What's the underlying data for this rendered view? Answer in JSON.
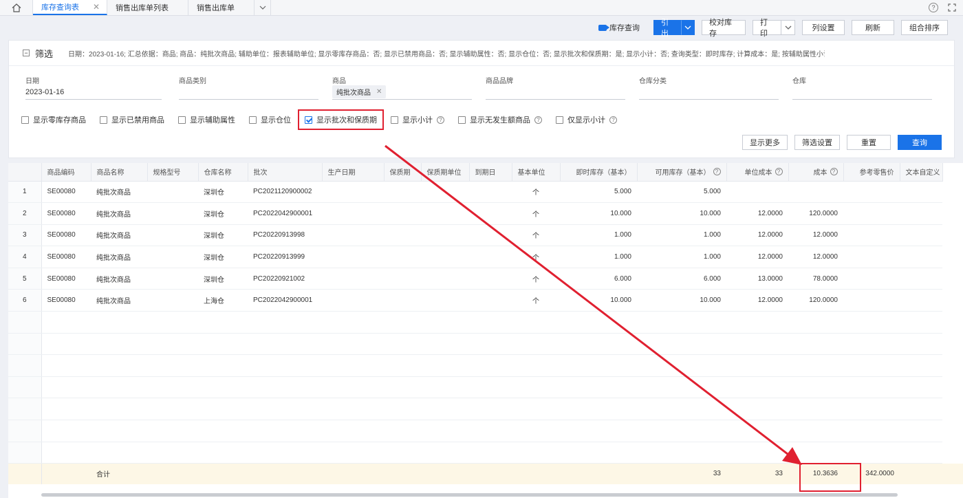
{
  "tabs": [
    {
      "label": "库存查询表",
      "active": true
    },
    {
      "label": "销售出库单列表",
      "active": false
    },
    {
      "label": "销售出库单",
      "active": false
    }
  ],
  "toolbar": {
    "live_query": "库存查询",
    "export": "引出",
    "verify_stock": "校对库存",
    "print": "打印",
    "column_settings": "列设置",
    "refresh": "刷新",
    "group_sort": "组合排序"
  },
  "filter": {
    "title": "筛选",
    "summary": "日期：2023-01-16; 汇总依据：商品; 商品：纯批次商品; 辅助单位：报表辅助单位; 显示零库存商品：否; 显示已禁用商品：否; 显示辅助属性：否; 显示仓位：否; 显示批次和保质期：是; 显示小计：否; 查询类型：即时库存; 计算成本：是; 按辅助属性小计：否",
    "fields": [
      {
        "label": "日期",
        "value": "2023-01-16"
      },
      {
        "label": "商品类别",
        "value": ""
      },
      {
        "label": "商品",
        "tag": "纯批次商品"
      },
      {
        "label": "商品品牌",
        "value": ""
      },
      {
        "label": "仓库分类",
        "value": ""
      },
      {
        "label": "仓库",
        "value": ""
      }
    ],
    "checkboxes": [
      {
        "label": "显示零库存商品",
        "checked": false
      },
      {
        "label": "显示已禁用商品",
        "checked": false
      },
      {
        "label": "显示辅助属性",
        "checked": false
      },
      {
        "label": "显示仓位",
        "checked": false
      },
      {
        "label": "显示批次和保质期",
        "checked": true
      },
      {
        "label": "显示小计",
        "checked": false
      },
      {
        "label": "显示无发生额商品",
        "checked": false
      },
      {
        "label": "仅显示小计",
        "checked": false
      }
    ],
    "buttons": {
      "more": "显示更多",
      "settings": "筛选设置",
      "reset": "重置",
      "query": "查询"
    }
  },
  "table": {
    "headers": [
      "商品编码",
      "商品名称",
      "规格型号",
      "仓库名称",
      "批次",
      "生产日期",
      "保质期",
      "保质期单位",
      "到期日",
      "基本单位",
      "即时库存（基本）",
      "可用库存（基本）",
      "单位成本",
      "成本",
      "参考零售价",
      "文本自定义"
    ],
    "rows": [
      {
        "idx": "1",
        "code": "SE00080",
        "name": "纯批次商品",
        "spec": "",
        "warehouse": "深圳仓",
        "batch": "PC2021120900002",
        "unit": "个",
        "stock": "5.000",
        "avail": "5.000",
        "unit_cost": "",
        "cost": ""
      },
      {
        "idx": "2",
        "code": "SE00080",
        "name": "纯批次商品",
        "spec": "",
        "warehouse": "深圳仓",
        "batch": "PC2022042900001",
        "unit": "个",
        "stock": "10.000",
        "avail": "10.000",
        "unit_cost": "12.0000",
        "cost": "120.0000"
      },
      {
        "idx": "3",
        "code": "SE00080",
        "name": "纯批次商品",
        "spec": "",
        "warehouse": "深圳仓",
        "batch": "PC20220913998",
        "unit": "个",
        "stock": "1.000",
        "avail": "1.000",
        "unit_cost": "12.0000",
        "cost": "12.0000"
      },
      {
        "idx": "4",
        "code": "SE00080",
        "name": "纯批次商品",
        "spec": "",
        "warehouse": "深圳仓",
        "batch": "PC20220913999",
        "unit": "个",
        "stock": "1.000",
        "avail": "1.000",
        "unit_cost": "12.0000",
        "cost": "12.0000"
      },
      {
        "idx": "5",
        "code": "SE00080",
        "name": "纯批次商品",
        "spec": "",
        "warehouse": "深圳仓",
        "batch": "PC20220921002",
        "unit": "个",
        "stock": "6.000",
        "avail": "6.000",
        "unit_cost": "13.0000",
        "cost": "78.0000"
      },
      {
        "idx": "6",
        "code": "SE00080",
        "name": "纯批次商品",
        "spec": "",
        "warehouse": "上海仓",
        "batch": "PC2022042900001",
        "unit": "个",
        "stock": "10.000",
        "avail": "10.000",
        "unit_cost": "12.0000",
        "cost": "120.0000"
      }
    ],
    "total": {
      "label": "合计",
      "stock": "33",
      "avail": "33",
      "unit_cost": "10.3636",
      "cost": "342.0000"
    }
  },
  "colors": {
    "accent": "#1a73e8",
    "annotation": "#e02030",
    "total_row": "#fdf7e6"
  }
}
